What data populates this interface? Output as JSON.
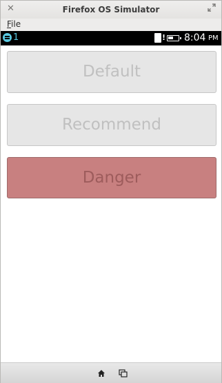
{
  "window": {
    "title": "Firefox OS Simulator",
    "close_glyph": "✕"
  },
  "menubar": {
    "file_accel": "F",
    "file_rest": "ile"
  },
  "statusbar": {
    "notification_count": "1",
    "sim_alert": "!",
    "battery_level": 0.55,
    "time": "8:04",
    "ampm": "PM",
    "accent_color": "#5ac8e0"
  },
  "buttons": {
    "default_label": "Default",
    "recommend_label": "Recommend",
    "danger_label": "Danger",
    "danger_color": "#c88080"
  },
  "softbar": {
    "icons": [
      "home-icon",
      "cards-icon"
    ]
  }
}
